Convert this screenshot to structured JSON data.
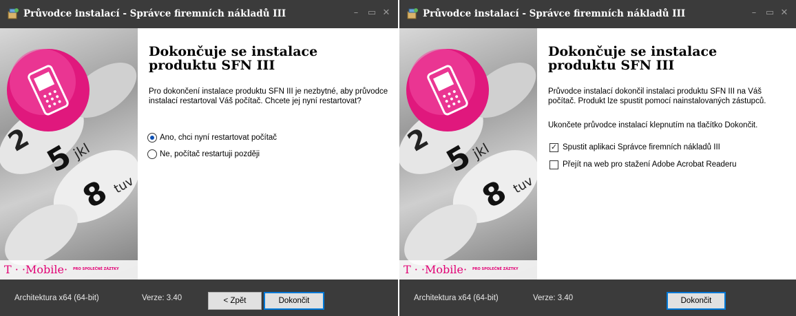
{
  "left_window": {
    "title": "Průvodce instalací - Správce firemních nákladů III",
    "heading": "Dokončuje se instalace produktu SFN III",
    "message": "Pro dokončení instalace produktu SFN III je nezbytné, aby průvodce instalací restartoval Váš počítač. Chcete jej nyní restartovat?",
    "options": [
      {
        "label": "Ano, chci nyní restartovat počítač",
        "checked": true
      },
      {
        "label": "Ne, počítač restartuji později",
        "checked": false
      }
    ],
    "architecture": "Architektura x64 (64-bit)",
    "version": "Verze: 3.40",
    "back_label": "< Zpět",
    "finish_label": "Dokončit"
  },
  "right_window": {
    "title": "Průvodce instalací - Správce firemních nákladů III",
    "heading": "Dokončuje se instalace produktu SFN III",
    "message": "Průvodce instalací dokončil instalaci produktu SFN III na Váš počítač. Produkt lze spustit pomocí nainstalovaných zástupců.",
    "message2": "Ukončete průvodce instalací klepnutím na tlačítko Dokončit.",
    "checkboxes": [
      {
        "label": "Spustit aplikaci Správce firemních nákladů III",
        "checked": true
      },
      {
        "label": "Přejít na web pro stažení Adobe Acrobat Readeru",
        "checked": false
      }
    ],
    "architecture": "Architektura x64 (64-bit)",
    "version": "Verze: 3.40",
    "finish_label": "Dokončit"
  },
  "brand": {
    "logo_text": "T · ·Mobile·",
    "tagline": "PRO SPOLEČNÉ ZÁZTKY"
  },
  "icons": {
    "app": "installer-box-icon",
    "minimize": "minimize-icon",
    "maximize": "maximize-icon",
    "close": "close-icon",
    "phone": "mobile-phone-icon",
    "checkmark": "checkmark-icon"
  },
  "colors": {
    "titlebar": "#3b3b3b",
    "brand_magenta": "#e20074",
    "accent_blue": "#0078d7"
  },
  "glyphs": {
    "minimize": "–",
    "maximize": "▭",
    "close": "✕",
    "check": "✓"
  }
}
